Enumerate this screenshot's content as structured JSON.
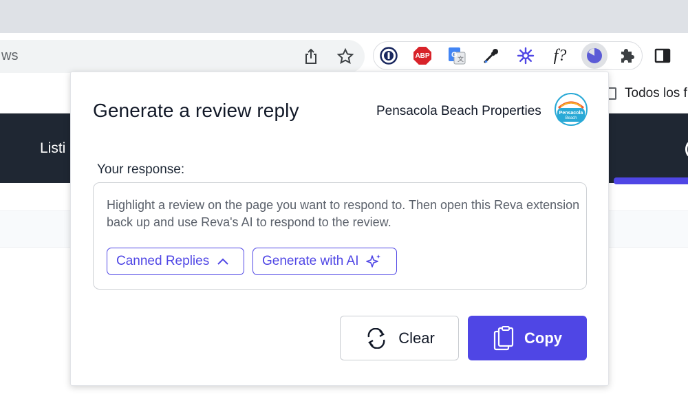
{
  "browser": {
    "omnibox_text": "ws",
    "bookmark_label": "Todos los f",
    "extensions": [
      "1password-icon",
      "adblock-plus-icon",
      "google-translate-icon",
      "eyedropper-icon",
      "sparkle-icon",
      "f-question-icon",
      "reva-icon",
      "puzzle-icon",
      "side-panel-icon"
    ],
    "abp_label": "ABP",
    "fx_label": "f?"
  },
  "page": {
    "nav_label": "Listi"
  },
  "popup": {
    "title": "Generate a review reply",
    "business_name": "Pensacola Beach Properties",
    "logo_text_1": "Pensacola",
    "logo_text_2": "Beach",
    "response_label": "Your response:",
    "response_placeholder": "Highlight a review on the page you want to respond to.  Then open this Reva extension back up and use Reva's AI to respond to the review.",
    "canned_replies_label": "Canned Replies",
    "generate_ai_label": "Generate with AI",
    "clear_label": "Clear",
    "copy_label": "Copy"
  },
  "colors": {
    "accent": "#4f46e5",
    "navbar": "#1f2733",
    "tabstrip": "#dee1e6"
  }
}
